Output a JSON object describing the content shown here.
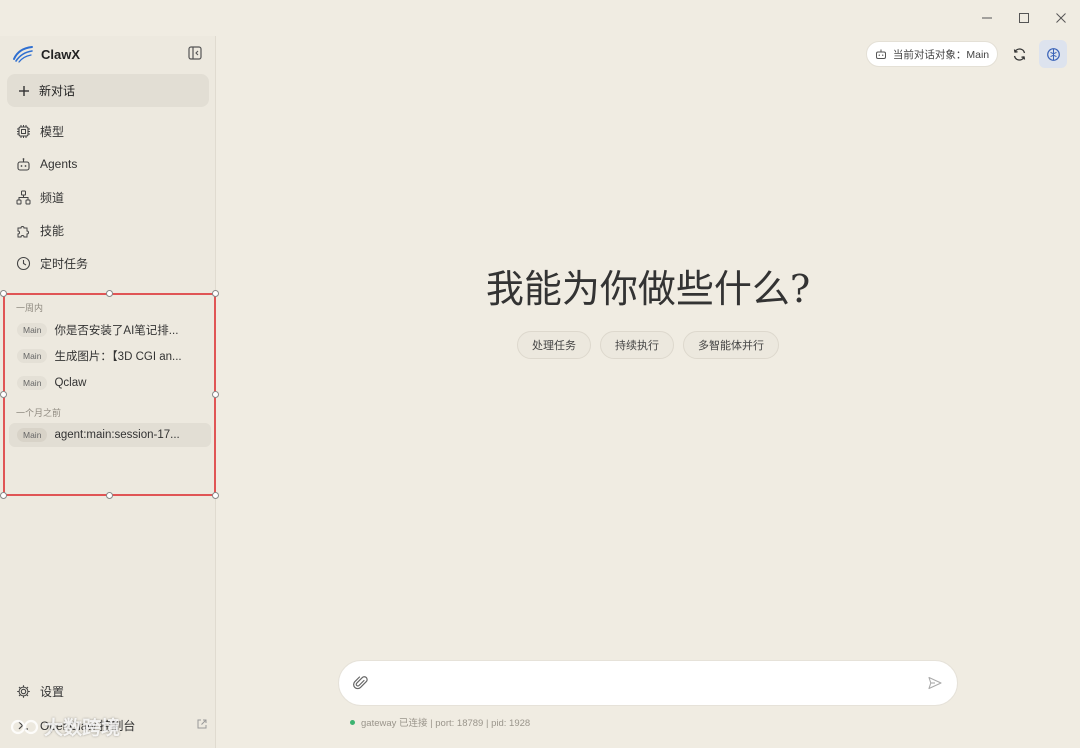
{
  "window": {
    "minimize_icon": "minimize-icon",
    "maximize_icon": "maximize-icon",
    "close_icon": "close-icon"
  },
  "sidebar": {
    "app_name": "ClawX",
    "new_chat_label": "新对话",
    "nav": [
      {
        "label": "模型",
        "icon": "chip-icon"
      },
      {
        "label": "Agents",
        "icon": "bot-icon"
      },
      {
        "label": "频道",
        "icon": "network-icon"
      },
      {
        "label": "技能",
        "icon": "puzzle-icon"
      },
      {
        "label": "定时任务",
        "icon": "clock-icon"
      }
    ],
    "history_groups": [
      {
        "label": "一周内",
        "sessions": [
          {
            "agent": "Main",
            "title": "你是否安装了AI笔记排..."
          },
          {
            "agent": "Main",
            "title": "生成图片：【3D CGI an..."
          },
          {
            "agent": "Main",
            "title": "Qclaw"
          }
        ]
      },
      {
        "label": "一个月之前",
        "sessions": [
          {
            "agent": "Main",
            "title": "agent:main:session-17..."
          }
        ]
      }
    ],
    "settings_label": "设置",
    "console_label": "OpenClaw 控制台"
  },
  "header": {
    "current_agent_label": "当前对话对象：Main"
  },
  "main": {
    "hero_title": "我能为你做些什么?",
    "suggestions": [
      "处理任务",
      "持续执行",
      "多智能体并行"
    ],
    "input_placeholder": "",
    "status_text": "gateway 已连接 | port: 18789 | pid: 1928"
  },
  "watermark": {
    "text": "大数跨境"
  },
  "colors": {
    "background": "#f0ece2",
    "sidebar": "#ede9df",
    "selection_border": "#e05555",
    "status_dot": "#3cb371"
  }
}
